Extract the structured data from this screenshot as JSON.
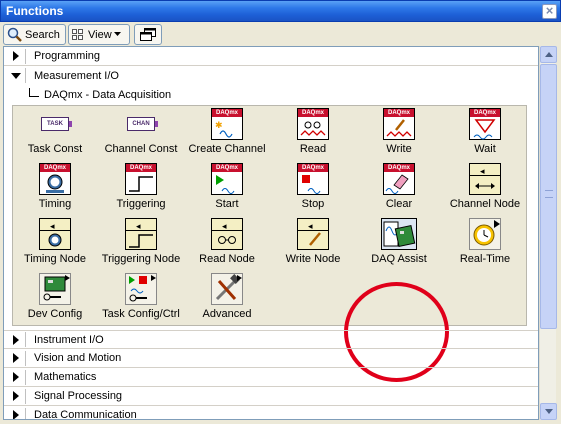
{
  "window": {
    "title": "Functions"
  },
  "toolbar": {
    "search_label": "Search",
    "view_label": "View"
  },
  "categories_top": [
    {
      "label": "Programming",
      "expanded": false
    },
    {
      "label": "Measurement I/O",
      "expanded": true
    }
  ],
  "subpalette": {
    "label": "DAQmx - Data Acquisition"
  },
  "palette_items": [
    {
      "label": "Task Const",
      "icon": "task-const-icon"
    },
    {
      "label": "Channel Const",
      "icon": "channel-const-icon"
    },
    {
      "label": "Create Channel",
      "icon": "create-channel-icon"
    },
    {
      "label": "Read",
      "icon": "read-icon"
    },
    {
      "label": "Write",
      "icon": "write-icon"
    },
    {
      "label": "Wait",
      "icon": "wait-icon"
    },
    {
      "label": "Timing",
      "icon": "timing-icon"
    },
    {
      "label": "Triggering",
      "icon": "triggering-icon"
    },
    {
      "label": "Start",
      "icon": "start-icon"
    },
    {
      "label": "Stop",
      "icon": "stop-icon"
    },
    {
      "label": "Clear",
      "icon": "clear-icon"
    },
    {
      "label": "Channel Node",
      "icon": "channel-node-icon"
    },
    {
      "label": "Timing Node",
      "icon": "timing-node-icon"
    },
    {
      "label": "Triggering Node",
      "icon": "triggering-node-icon"
    },
    {
      "label": "Read Node",
      "icon": "read-node-icon"
    },
    {
      "label": "Write Node",
      "icon": "write-node-icon"
    },
    {
      "label": "DAQ Assist",
      "icon": "daq-assist-icon"
    },
    {
      "label": "Real-Time",
      "icon": "real-time-icon"
    },
    {
      "label": "Dev Config",
      "icon": "dev-config-icon"
    },
    {
      "label": "Task Config/Ctrl",
      "icon": "task-config-icon"
    },
    {
      "label": "Advanced",
      "icon": "advanced-icon"
    }
  ],
  "icon_text": {
    "daqmx": "DAQmx",
    "task": "TASK",
    "chan": "CHAN"
  },
  "categories_bottom": [
    {
      "label": "Instrument I/O"
    },
    {
      "label": "Vision and Motion"
    },
    {
      "label": "Mathematics"
    },
    {
      "label": "Signal Processing"
    },
    {
      "label": "Data Communication"
    }
  ],
  "colors": {
    "daqmx_red": "#c8102e",
    "highlight_circle": "#e0001a",
    "titlebar_blue": "#1d5fd6"
  }
}
